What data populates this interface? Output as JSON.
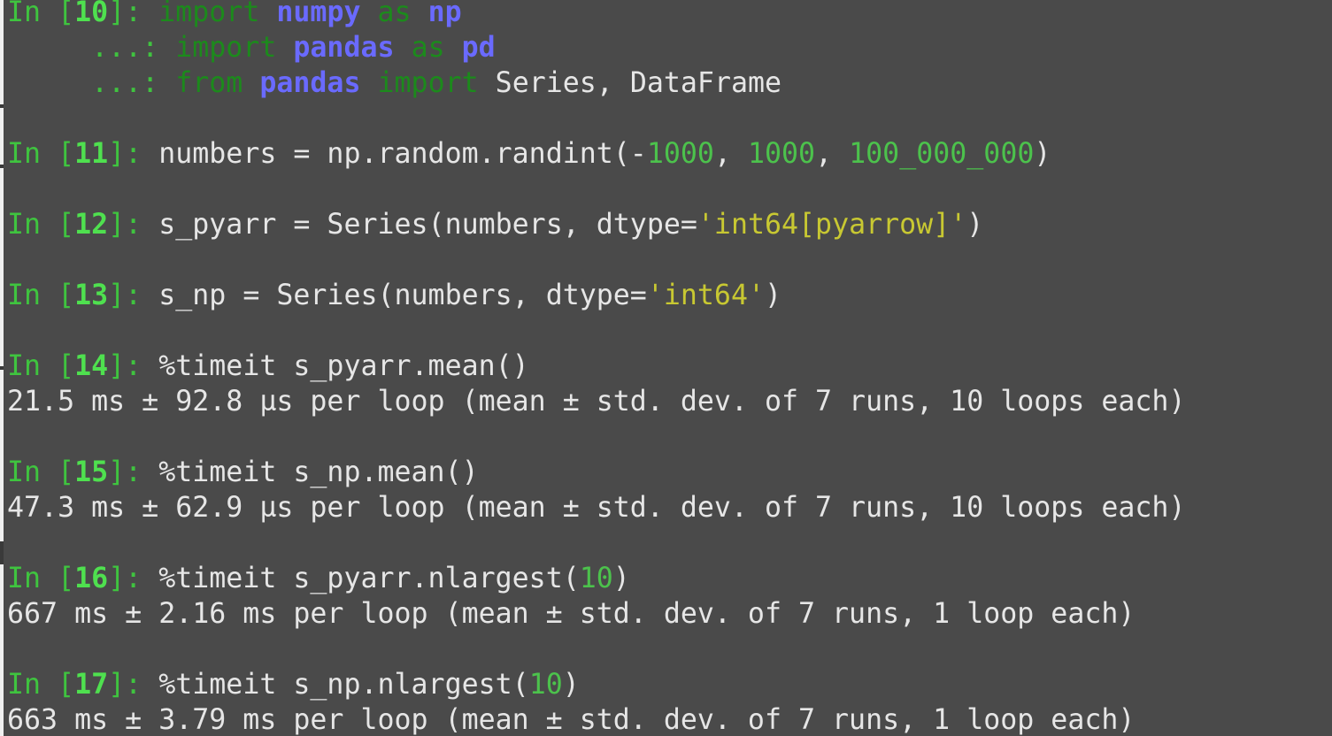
{
  "colors": {
    "background": "#4a4a4a",
    "prompt": "#3fc43f",
    "keyword": "#1c8a1c",
    "module": "#6a6aff",
    "number": "#4cc24c",
    "string": "#c8c832",
    "text": "#e6e6e6"
  },
  "cells": [
    {
      "number": "10",
      "code_lines": [
        "import numpy as np",
        "import pandas as pd",
        "from pandas import Series, DataFrame"
      ]
    },
    {
      "number": "11",
      "code": "numbers = np.random.randint(-1000, 1000, 100_000_000)"
    },
    {
      "number": "12",
      "code": "s_pyarr = Series(numbers, dtype='int64[pyarrow]')"
    },
    {
      "number": "13",
      "code": "s_np = Series(numbers, dtype='int64')"
    },
    {
      "number": "14",
      "code": "%timeit s_pyarr.mean()",
      "output": "21.5 ms ± 92.8 µs per loop (mean ± std. dev. of 7 runs, 10 loops each)"
    },
    {
      "number": "15",
      "code": "%timeit s_np.mean()",
      "output": "47.3 ms ± 62.9 µs per loop (mean ± std. dev. of 7 runs, 10 loops each)"
    },
    {
      "number": "16",
      "code": "%timeit s_pyarr.nlargest(10)",
      "output": "667 ms ± 2.16 ms per loop (mean ± std. dev. of 7 runs, 1 loop each)"
    },
    {
      "number": "17",
      "code": "%timeit s_np.nlargest(10)",
      "output": "663 ms ± 3.79 ms per loop (mean ± std. dev. of 7 runs, 1 loop each)"
    }
  ]
}
